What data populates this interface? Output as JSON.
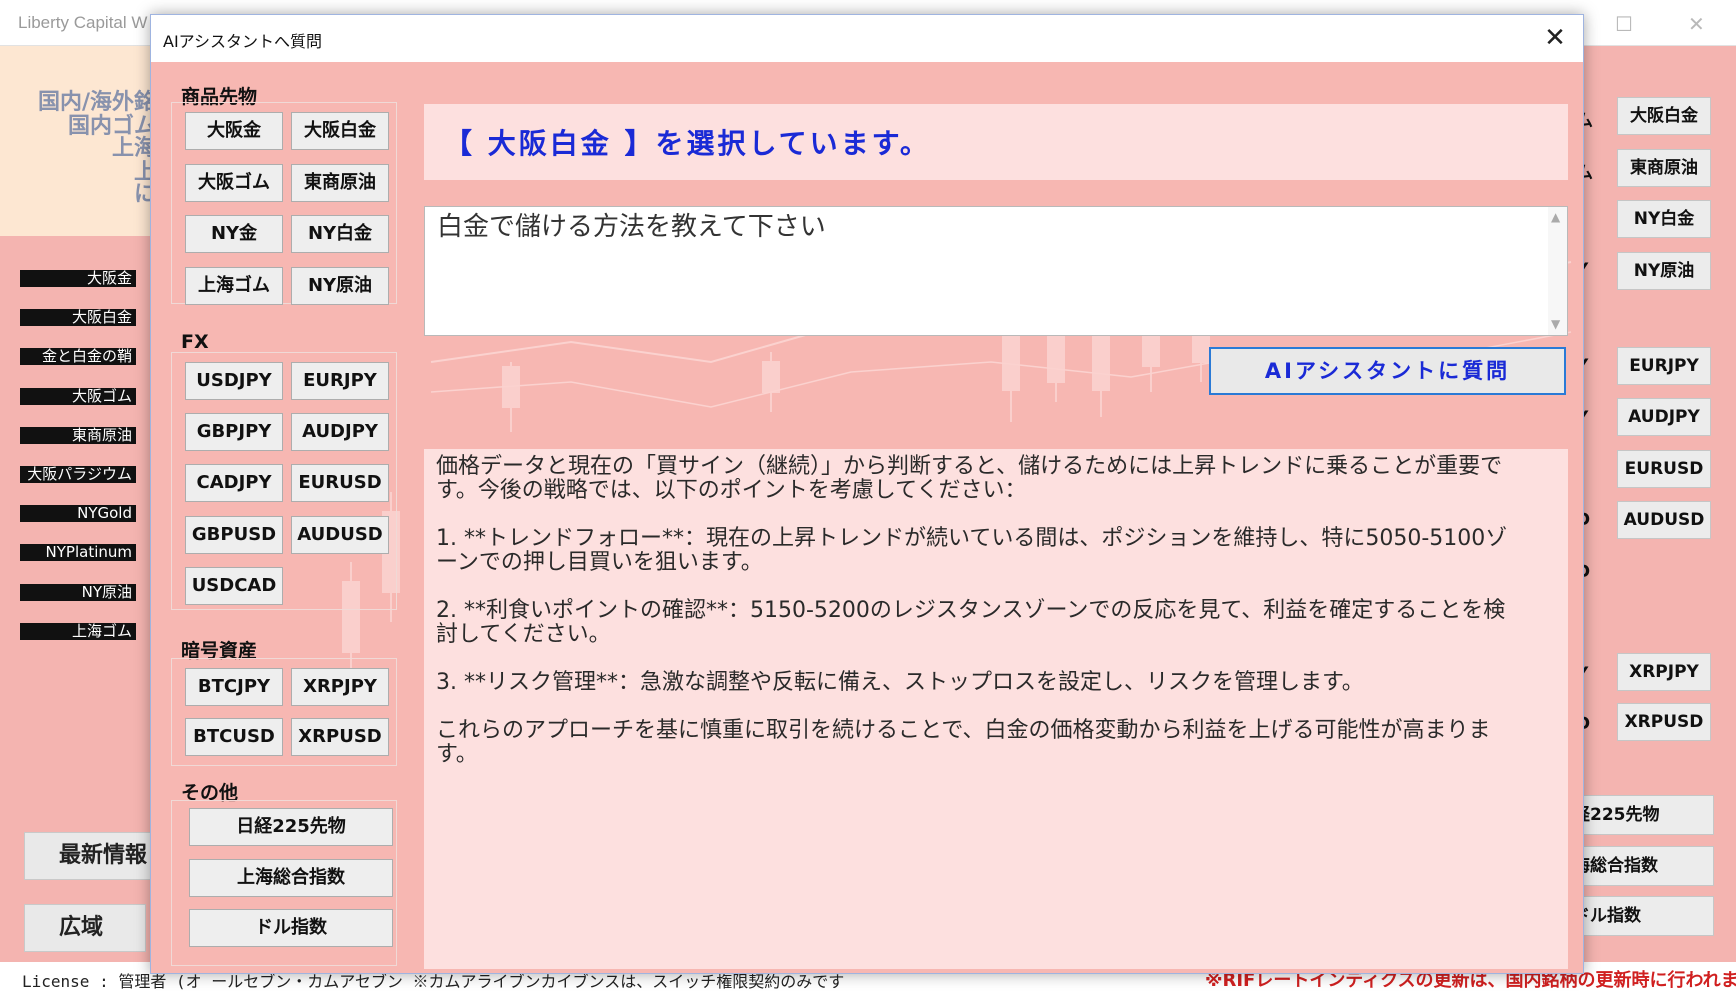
{
  "background_window": {
    "title": "Liberty Capital W",
    "window_controls": {
      "maximize": "☐",
      "close": "✕"
    },
    "info_lines": [
      "国内/海外銘",
      "国内ゴム",
      "上海",
      "上",
      "に"
    ],
    "side_labels": [
      "大阪金",
      "大阪白金",
      "金と白金の鞘",
      "大阪ゴム",
      "東商原油",
      "大阪パラジウム",
      "NYGold",
      "NYPlatinum",
      "NY原油",
      "上海ゴム"
    ],
    "buttons": {
      "latest_info": "最新情報",
      "wide_area": "広域"
    },
    "right_buttons": [
      "大阪白金",
      "東商原油",
      "NY白金",
      "NY原油",
      "EURJPY",
      "AUDJPY",
      "EURUSD",
      "AUDUSD",
      "XRPJPY",
      "XRPUSD"
    ],
    "right_wide_buttons": [
      "経225先物",
      "海総合指数",
      "ドル指数"
    ],
    "right_fragments": [
      "ム",
      "ム",
      "Y",
      "Y",
      "Y",
      "D",
      "D",
      "Y",
      "D"
    ],
    "license_text": "License : 管理者 (オ  ールセブン・カムアセブン   ※カムアライブンカイブンスは、スイッチ権限契約のみです",
    "bottom_notice": "※RIFレートインディクスの更新は、国内銘柄の更新時に行われます"
  },
  "dialog": {
    "title": "AIアシスタントへ質問",
    "close_symbol": "✕",
    "groups": {
      "commodities": {
        "label": "商品先物",
        "buttons": [
          "大阪金",
          "大阪白金",
          "大阪ゴム",
          "東商原油",
          "NY金",
          "NY白金",
          "上海ゴム",
          "NY原油"
        ]
      },
      "fx": {
        "label": "FX",
        "buttons": [
          "USDJPY",
          "EURJPY",
          "GBPJPY",
          "AUDJPY",
          "CADJPY",
          "EURUSD",
          "GBPUSD",
          "AUDUSD",
          "USDCAD"
        ]
      },
      "crypto": {
        "label": "暗号資産",
        "buttons": [
          "BTCJPY",
          "XRPJPY",
          "BTCUSD",
          "XRPUSD"
        ]
      },
      "other": {
        "label": "その他",
        "buttons": [
          "日経225先物",
          "上海総合指数",
          "ドル指数"
        ]
      }
    },
    "selection_text": "【 大阪白金 】を選択しています。",
    "question_value": "白金で儲ける方法を教えて下さい",
    "scroll_up": "▲",
    "scroll_down": "▼",
    "ask_button": "AIアシスタントに質問",
    "answer_paragraphs": [
      "価格データと現在の「買サイン（継続）」から判断すると、儲けるためには上昇トレンドに乗ることが重要です。今後の戦略では、以下のポイントを考慮してください：",
      "1. **トレンドフォロー**：現在の上昇トレンドが続いている間は、ポジションを維持し、特に5050-5100ゾーンでの押し目買いを狙います。",
      "2. **利食いポイントの確認**：5150-5200のレジスタンスゾーンでの反応を見て、利益を確定することを検討してください。",
      "3. **リスク管理**：急激な調整や反転に備え、ストップロスを設定し、リスクを管理します。",
      "これらのアプローチを基に慎重に取引を続けることで、白金の価格変動から利益を上げる可能性が高まります。"
    ]
  },
  "colors": {
    "dialog_bg": "#f7b7b2",
    "panel_bg": "#fde0df",
    "accent_blue": "#1a2ad6",
    "button_border_blue": "#2a7ad6"
  }
}
